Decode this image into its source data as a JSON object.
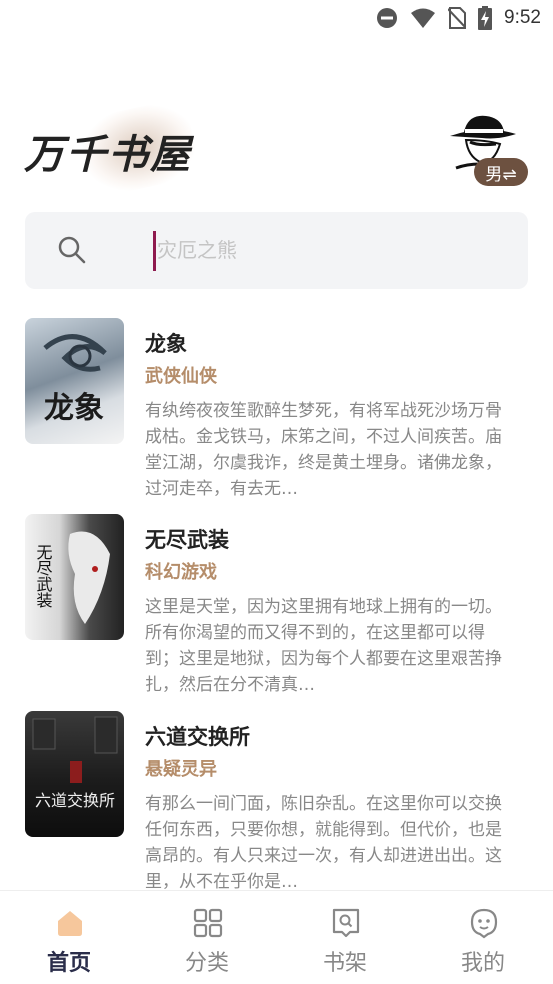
{
  "status": {
    "time": "9:52"
  },
  "header": {
    "logo_text": "万千书屋",
    "gender": "男⇌"
  },
  "search": {
    "placeholder": "灾厄之熊"
  },
  "books": [
    {
      "title": "龙象",
      "genre": "武侠仙侠",
      "desc": "有纨绔夜夜笙歌醉生梦死，有将军战死沙场万骨成枯。金戈铁马，床笫之间，不过人间疾苦。庙堂江湖，尔虞我诈，终是黄土埋身。诸佛龙象，过河走卒，有去无…",
      "cover_text": "龙象"
    },
    {
      "title": "无尽武装",
      "genre": "科幻游戏",
      "desc": "这里是天堂，因为这里拥有地球上拥有的一切。所有你渴望的而又得不到的，在这里都可以得到；这里是地狱，因为每个人都要在这里艰苦挣扎，然后在分不清真…",
      "cover_text": "无尽武装"
    },
    {
      "title": "六道交换所",
      "genre": "悬疑灵异",
      "desc": "有那么一间门面，陈旧杂乱。在这里你可以交换任何东西，只要你想，就能得到。但代价，也是高昂的。有人只来过一次，有人却进进出出。这里，从不在乎你是…",
      "cover_text": "六道交换所"
    }
  ],
  "tabs": [
    {
      "label": "首页",
      "icon": "home-icon",
      "active": true
    },
    {
      "label": "分类",
      "icon": "category-icon",
      "active": false
    },
    {
      "label": "书架",
      "icon": "bookshelf-icon",
      "active": false
    },
    {
      "label": "我的",
      "icon": "profile-icon",
      "active": false
    }
  ],
  "colors": {
    "accent": "#b58d6a",
    "active_tab": "#2a2d4a",
    "home_icon": "#f6c79c",
    "gender_bg": "#6d5140"
  }
}
